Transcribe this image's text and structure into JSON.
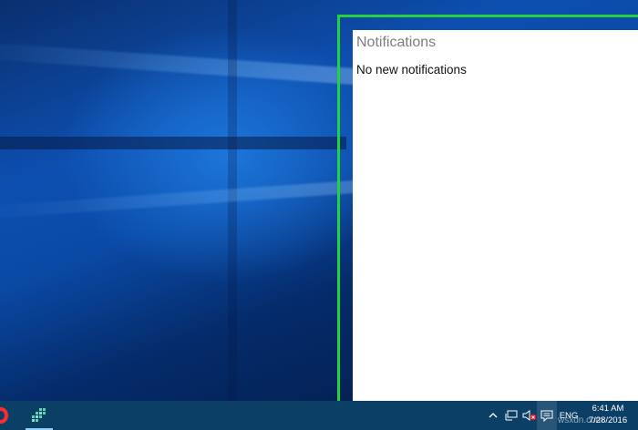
{
  "desktop": {
    "wallpaper": "windows-10-hero"
  },
  "action_center": {
    "title": "Notifications",
    "empty_message": "No new notifications"
  },
  "highlight": {
    "color": "#23d23c"
  },
  "taskbar": {
    "color": "#0b3f66",
    "pinned": [
      {
        "name": "opera-icon",
        "color": "#ff2b2b"
      },
      {
        "name": "app-icon",
        "color": "#5fd1b0"
      }
    ],
    "tray": {
      "chevron_icon": "chevron-up-icon",
      "network_icon": "network-icon",
      "volume_icon": "volume-muted-icon",
      "action_center_icon": "action-center-icon",
      "language": "ENG"
    },
    "clock": {
      "time": "6:41 AM",
      "date": "7/28/2016"
    }
  },
  "watermark": {
    "text": "wsxdn.com"
  }
}
